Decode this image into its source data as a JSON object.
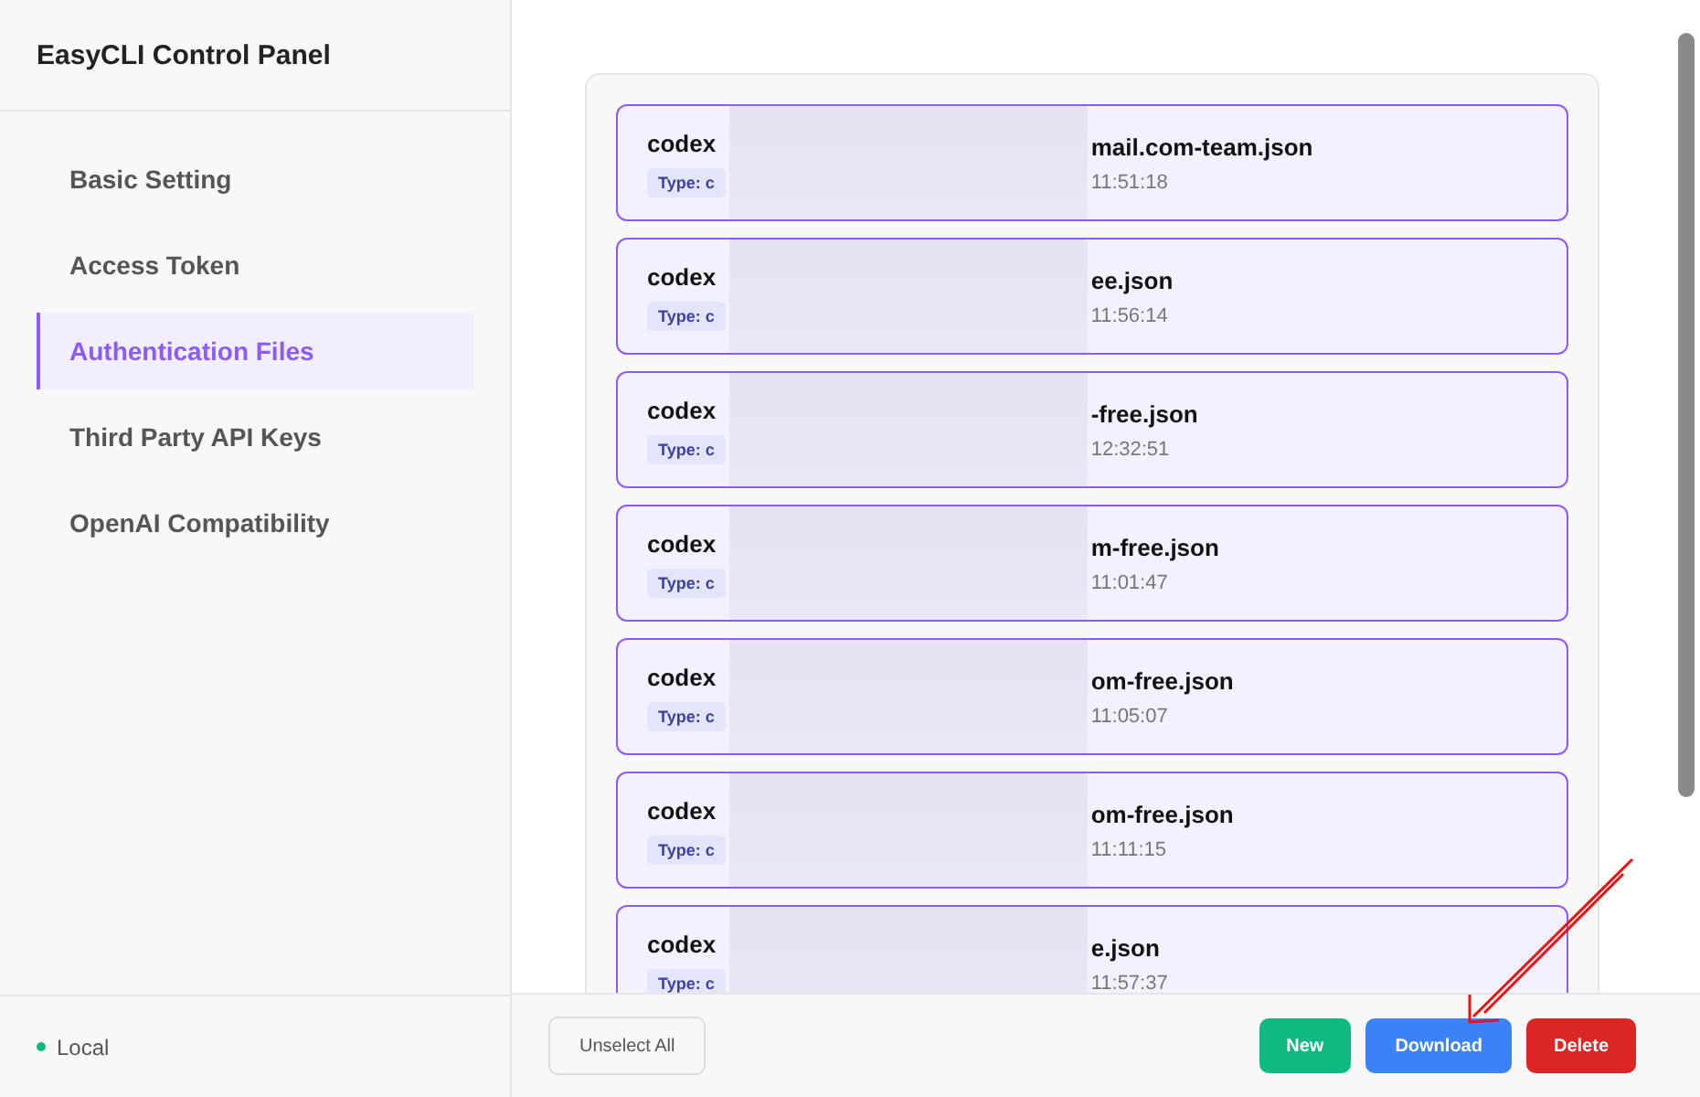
{
  "sidebar": {
    "title": "EasyCLI Control Panel",
    "items": [
      {
        "label": "Basic Setting",
        "selected": false
      },
      {
        "label": "Access Token",
        "selected": false
      },
      {
        "label": "Authentication Files",
        "selected": true
      },
      {
        "label": "Third Party API Keys",
        "selected": false
      },
      {
        "label": "OpenAI Compatibility",
        "selected": false
      }
    ],
    "status": {
      "label": "Local",
      "color": "#10b981"
    }
  },
  "files": [
    {
      "name_start": "codex",
      "name_end": "mail.com-team.json",
      "type": "Type: c",
      "time": "11:51:18",
      "selected": true
    },
    {
      "name_start": "codex",
      "name_end": "ee.json",
      "type": "Type: c",
      "time": "11:56:14",
      "selected": true
    },
    {
      "name_start": "codex",
      "name_end": "-free.json",
      "type": "Type: c",
      "time": "12:32:51",
      "selected": true
    },
    {
      "name_start": "codex",
      "name_end": "m-free.json",
      "type": "Type: c",
      "time": "11:01:47",
      "selected": true
    },
    {
      "name_start": "codex",
      "name_end": "om-free.json",
      "type": "Type: c",
      "time": "11:05:07",
      "selected": true
    },
    {
      "name_start": "codex",
      "name_end": "om-free.json",
      "type": "Type: c",
      "time": "11:11:15",
      "selected": true
    },
    {
      "name_start": "codex",
      "name_end": "e.json",
      "type": "Type: c",
      "time": "11:57:37",
      "selected": true
    }
  ],
  "actions": {
    "unselect": "Unselect All",
    "buttons": [
      {
        "label": "New",
        "kind": "new"
      },
      {
        "label": "Download",
        "kind": "download"
      },
      {
        "label": "Delete",
        "kind": "delete"
      }
    ]
  }
}
